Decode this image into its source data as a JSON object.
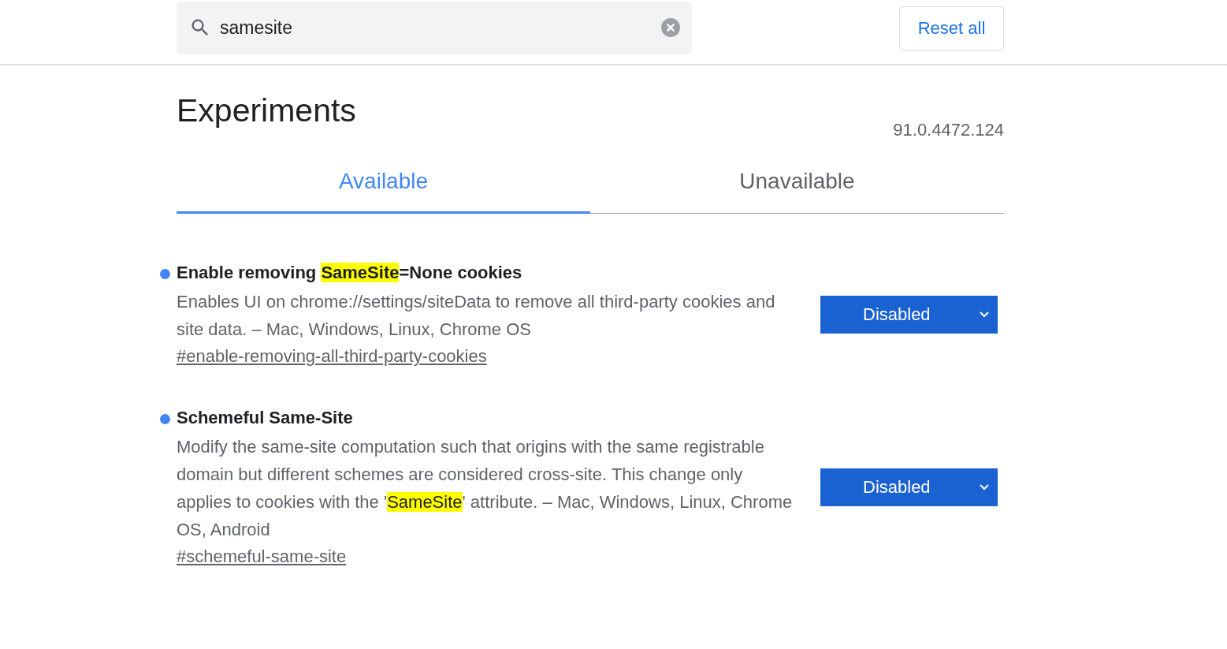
{
  "search": {
    "value": "samesite"
  },
  "reset_button": "Reset all",
  "title": "Experiments",
  "version": "91.0.4472.124",
  "tabs": [
    {
      "label": "Available",
      "selected": true
    },
    {
      "label": "Unavailable",
      "selected": false
    }
  ],
  "experiments": [
    {
      "title": [
        {
          "text": "Enable removing ",
          "highlighted": false
        },
        {
          "text": "SameSite",
          "highlighted": true
        },
        {
          "text": "=None cookies",
          "highlighted": false
        }
      ],
      "description": [
        {
          "text": "Enables UI on chrome://settings/siteData to remove all third-party cookies and site data. – Mac, Windows, Linux, Chrome OS",
          "highlighted": false
        }
      ],
      "link": "#enable-removing-all-third-party-cookies",
      "value": "Disabled"
    },
    {
      "title": [
        {
          "text": "Schemeful Same-Site",
          "highlighted": false
        }
      ],
      "description": [
        {
          "text": "Modify the same-site computation such that origins with the same registrable domain but different schemes are considered cross-site. This change only applies to cookies with the '",
          "highlighted": false
        },
        {
          "text": "SameSite",
          "highlighted": true
        },
        {
          "text": "' attribute. – Mac, Windows, Linux, Chrome OS, Android",
          "highlighted": false
        }
      ],
      "link": "#schemeful-same-site",
      "value": "Disabled"
    }
  ]
}
